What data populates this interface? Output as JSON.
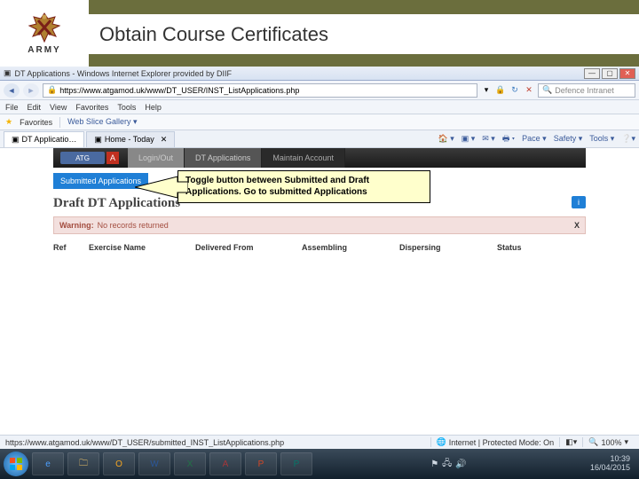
{
  "slide": {
    "army_label": "ARMY",
    "title": "Obtain Course Certificates"
  },
  "ie": {
    "window_title": "DT Applications - Windows Internet Explorer provided by DIIF",
    "url": "https://www.atgamod.uk/www/DT_USER/INST_ListApplications.php",
    "search_placeholder": "Defence Intranet",
    "menu": [
      "File",
      "Edit",
      "View",
      "Favorites",
      "Tools",
      "Help"
    ],
    "favorites_label": "Favorites",
    "fav_link": "Web Slice Gallery ▾",
    "tab1": "DT Applicatio…",
    "tab2": "Home - Today",
    "toolmenu": [
      "Pace ▾",
      "Safety ▾",
      "Tools ▾"
    ],
    "status_url": "https://www.atgamod.uk/www/DT_USER/submitted_INST_ListApplications.php",
    "status_zone": "Internet | Protected Mode: On",
    "status_zoom": "100%"
  },
  "nav": {
    "brand": "ATG",
    "brand_a": "A",
    "items": [
      "Login/Out",
      "DT Applications",
      "Maintain Account"
    ]
  },
  "page": {
    "toggle_btn": "Submitted Applications",
    "section_title": "Draft DT Applications",
    "info_btn": "i",
    "warning_label": "Warning:",
    "warning_text": "No records returned",
    "warning_close": "X",
    "columns": [
      "Ref",
      "Exercise Name",
      "Delivered From",
      "Assembling",
      "Dispersing",
      "Status"
    ]
  },
  "callout": {
    "line1": "Toggle button between Submitted and Draft",
    "line2": "Applications. Go to submitted Applications"
  },
  "taskbar": {
    "time": "10:39",
    "date": "16/04/2015"
  }
}
